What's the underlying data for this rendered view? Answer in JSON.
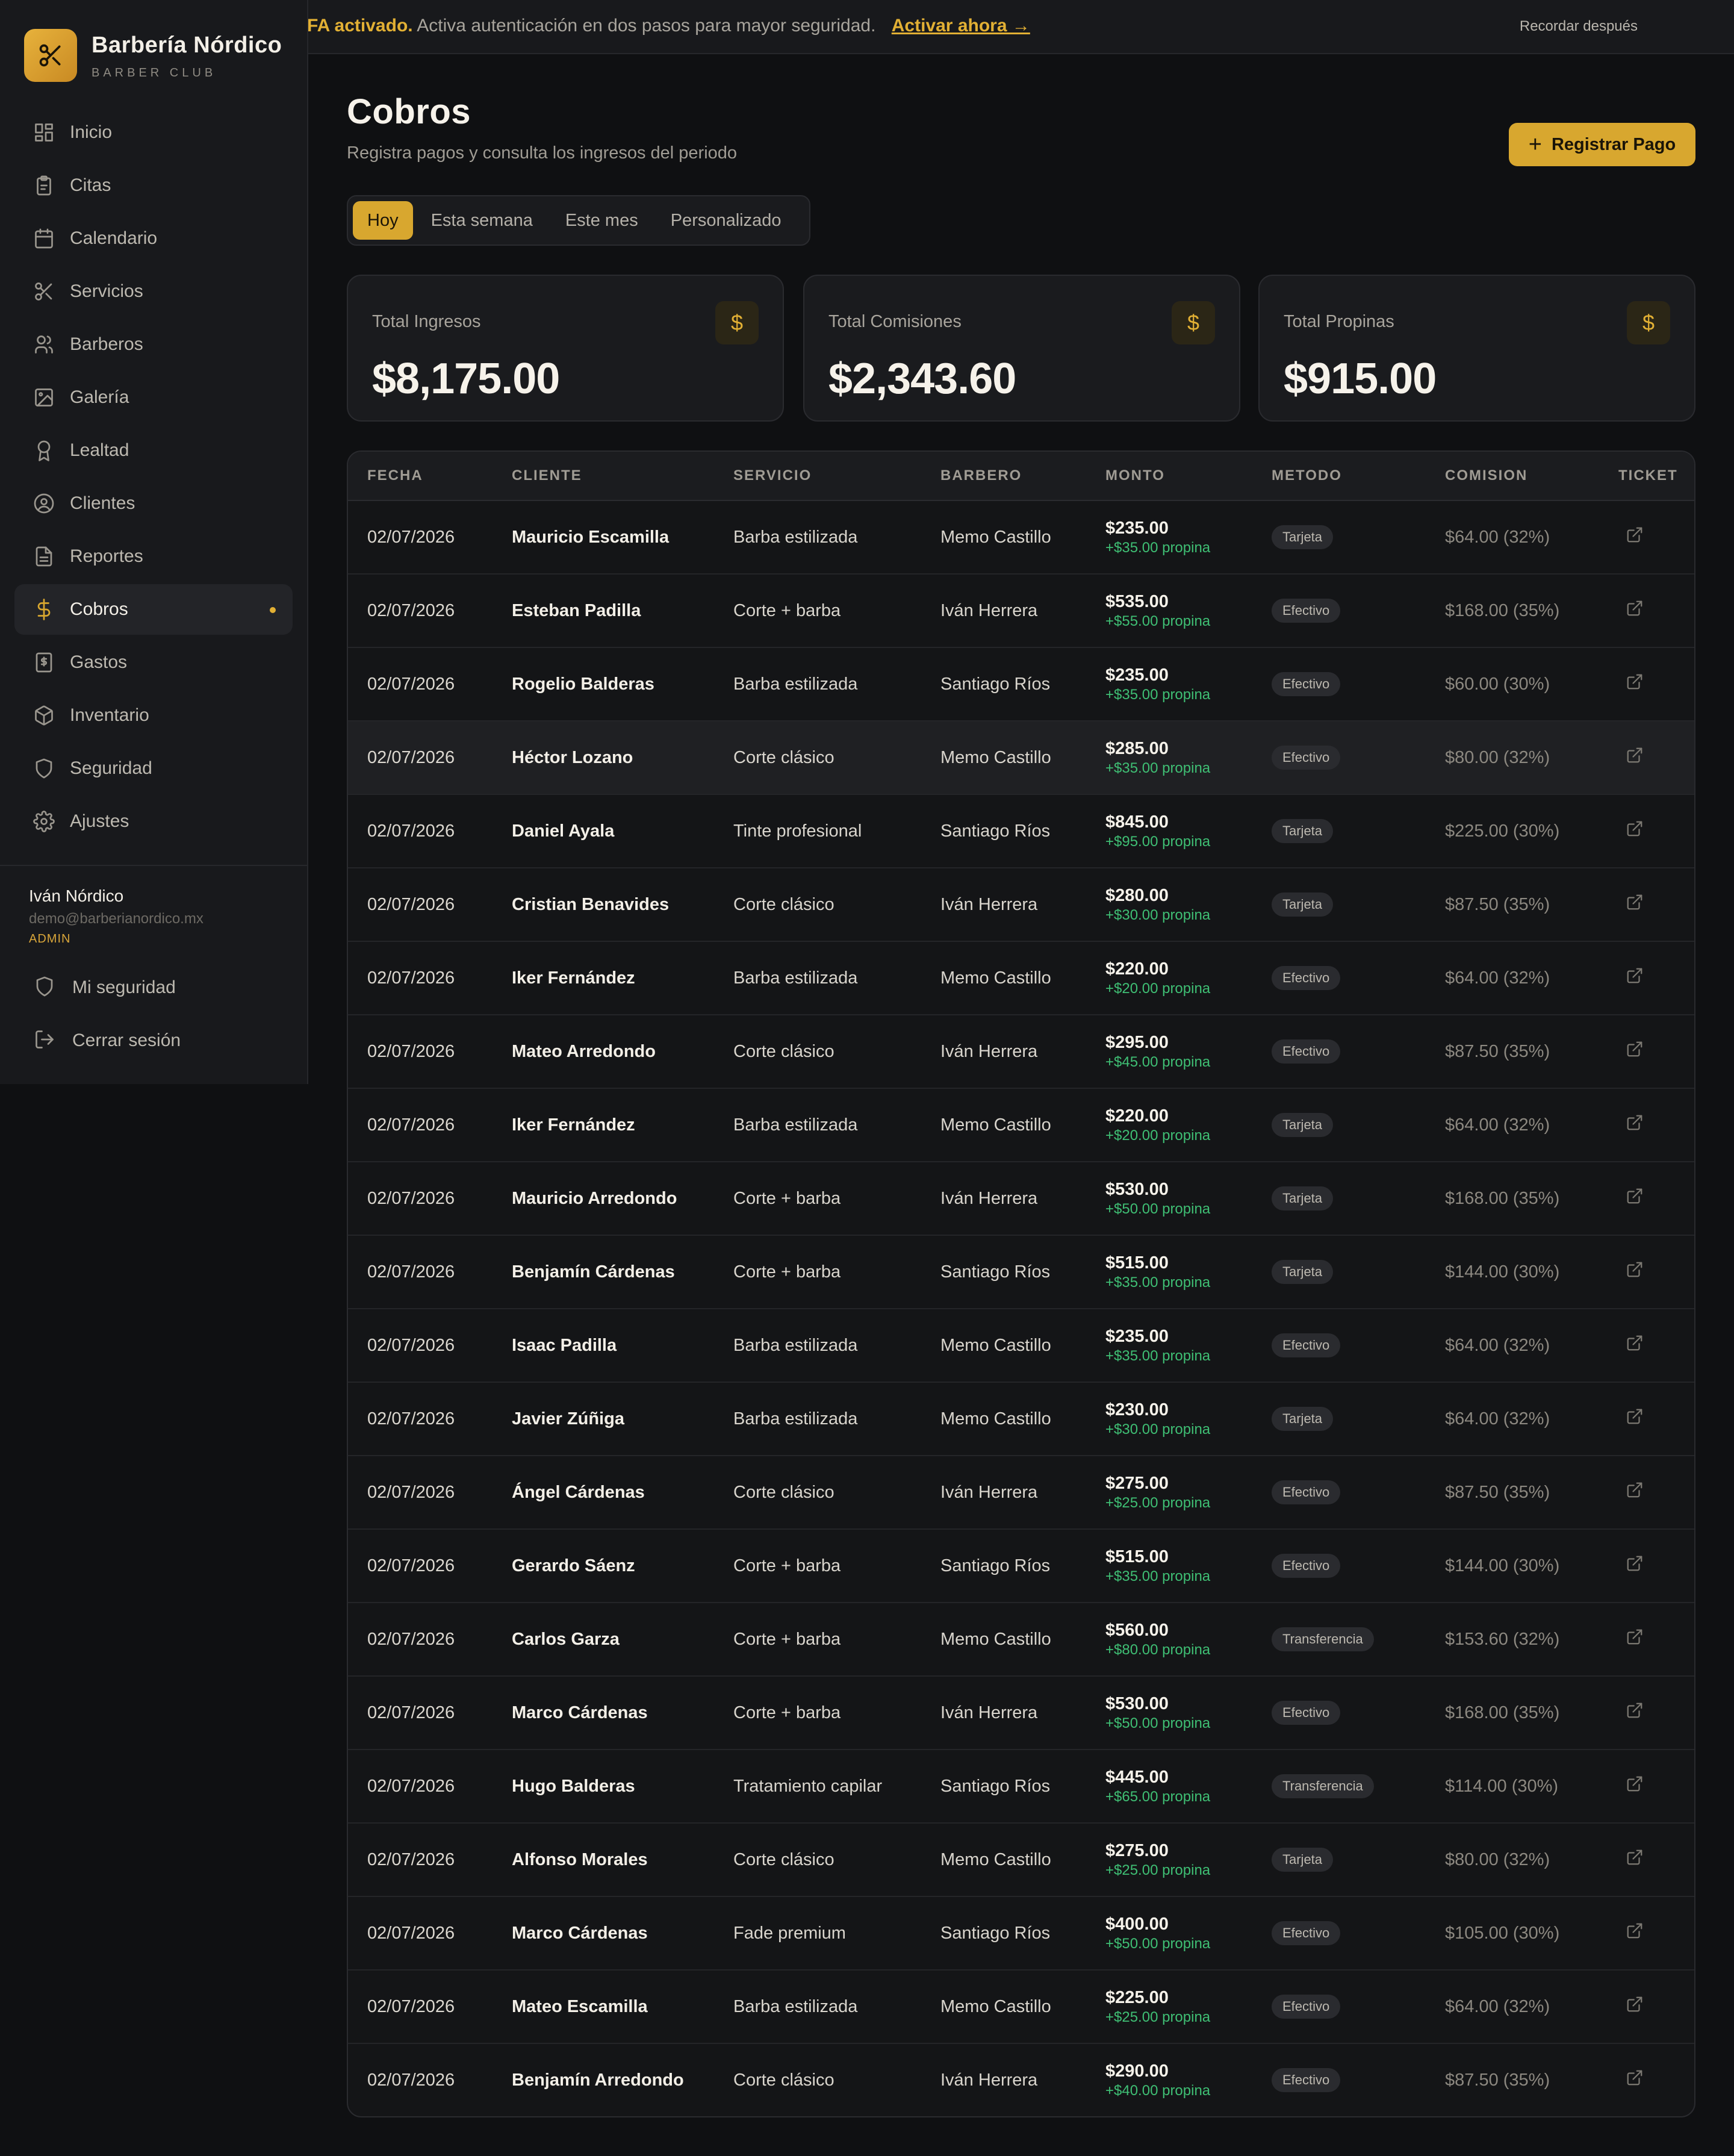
{
  "banner": {
    "strong": "FA activado.",
    "text": "Activa autenticación en dos pasos para mayor seguridad.",
    "link": "Activar ahora →",
    "later": "Recordar después"
  },
  "brand": {
    "name": "Barbería Nórdico",
    "sub": "BARBER CLUB"
  },
  "nav": [
    {
      "label": "Inicio",
      "icon": "grid-icon"
    },
    {
      "label": "Citas",
      "icon": "clipboard-icon"
    },
    {
      "label": "Calendario",
      "icon": "calendar-icon"
    },
    {
      "label": "Servicios",
      "icon": "scissors-icon"
    },
    {
      "label": "Barberos",
      "icon": "users-icon"
    },
    {
      "label": "Galería",
      "icon": "image-icon"
    },
    {
      "label": "Lealtad",
      "icon": "award-icon"
    },
    {
      "label": "Clientes",
      "icon": "user-circle-icon"
    },
    {
      "label": "Reportes",
      "icon": "file-text-icon"
    },
    {
      "label": "Cobros",
      "icon": "dollar-icon",
      "active": true
    },
    {
      "label": "Gastos",
      "icon": "receipt-icon"
    },
    {
      "label": "Inventario",
      "icon": "package-icon"
    },
    {
      "label": "Seguridad",
      "icon": "shield-icon"
    },
    {
      "label": "Ajustes",
      "icon": "gear-icon"
    }
  ],
  "user": {
    "name": "Iván Nórdico",
    "email": "demo@barberianordico.mx",
    "role": "ADMIN",
    "security_label": "Mi seguridad",
    "logout_label": "Cerrar sesión"
  },
  "page": {
    "title": "Cobros",
    "subtitle": "Registra pagos y consulta los ingresos del periodo",
    "register_button": "Registrar Pago"
  },
  "tabs": [
    {
      "label": "Hoy",
      "active": true
    },
    {
      "label": "Esta semana"
    },
    {
      "label": "Este mes"
    },
    {
      "label": "Personalizado"
    }
  ],
  "stats": [
    {
      "label": "Total Ingresos",
      "value": "$8,175.00",
      "icon": "$"
    },
    {
      "label": "Total Comisiones",
      "value": "$2,343.60",
      "icon": "$"
    },
    {
      "label": "Total Propinas",
      "value": "$915.00",
      "icon": "$"
    }
  ],
  "table": {
    "headers": [
      "FECHA",
      "CLIENTE",
      "SERVICIO",
      "BARBERO",
      "MONTO",
      "METODO",
      "COMISION",
      "TICKET"
    ],
    "rows": [
      {
        "date": "02/07/2026",
        "client": "Mauricio Escamilla",
        "service": "Barba estilizada",
        "barber": "Memo Castillo",
        "amount": "$235.00",
        "tip": "+$35.00 propina",
        "method": "Tarjeta",
        "commission": "$64.00 (32%)"
      },
      {
        "date": "02/07/2026",
        "client": "Esteban Padilla",
        "service": "Corte + barba",
        "barber": "Iván Herrera",
        "amount": "$535.00",
        "tip": "+$55.00 propina",
        "method": "Efectivo",
        "commission": "$168.00 (35%)"
      },
      {
        "date": "02/07/2026",
        "client": "Rogelio Balderas",
        "service": "Barba estilizada",
        "barber": "Santiago Ríos",
        "amount": "$235.00",
        "tip": "+$35.00 propina",
        "method": "Efectivo",
        "commission": "$60.00 (30%)"
      },
      {
        "date": "02/07/2026",
        "client": "Héctor Lozano",
        "service": "Corte clásico",
        "barber": "Memo Castillo",
        "amount": "$285.00",
        "tip": "+$35.00 propina",
        "method": "Efectivo",
        "commission": "$80.00 (32%)",
        "highlight": true
      },
      {
        "date": "02/07/2026",
        "client": "Daniel Ayala",
        "service": "Tinte profesional",
        "barber": "Santiago Ríos",
        "amount": "$845.00",
        "tip": "+$95.00 propina",
        "method": "Tarjeta",
        "commission": "$225.00 (30%)"
      },
      {
        "date": "02/07/2026",
        "client": "Cristian Benavides",
        "service": "Corte clásico",
        "barber": "Iván Herrera",
        "amount": "$280.00",
        "tip": "+$30.00 propina",
        "method": "Tarjeta",
        "commission": "$87.50 (35%)"
      },
      {
        "date": "02/07/2026",
        "client": "Iker Fernández",
        "service": "Barba estilizada",
        "barber": "Memo Castillo",
        "amount": "$220.00",
        "tip": "+$20.00 propina",
        "method": "Efectivo",
        "commission": "$64.00 (32%)"
      },
      {
        "date": "02/07/2026",
        "client": "Mateo Arredondo",
        "service": "Corte clásico",
        "barber": "Iván Herrera",
        "amount": "$295.00",
        "tip": "+$45.00 propina",
        "method": "Efectivo",
        "commission": "$87.50 (35%)"
      },
      {
        "date": "02/07/2026",
        "client": "Iker Fernández",
        "service": "Barba estilizada",
        "barber": "Memo Castillo",
        "amount": "$220.00",
        "tip": "+$20.00 propina",
        "method": "Tarjeta",
        "commission": "$64.00 (32%)"
      },
      {
        "date": "02/07/2026",
        "client": "Mauricio Arredondo",
        "service": "Corte + barba",
        "barber": "Iván Herrera",
        "amount": "$530.00",
        "tip": "+$50.00 propina",
        "method": "Tarjeta",
        "commission": "$168.00 (35%)"
      },
      {
        "date": "02/07/2026",
        "client": "Benjamín Cárdenas",
        "service": "Corte + barba",
        "barber": "Santiago Ríos",
        "amount": "$515.00",
        "tip": "+$35.00 propina",
        "method": "Tarjeta",
        "commission": "$144.00 (30%)"
      },
      {
        "date": "02/07/2026",
        "client": "Isaac Padilla",
        "service": "Barba estilizada",
        "barber": "Memo Castillo",
        "amount": "$235.00",
        "tip": "+$35.00 propina",
        "method": "Efectivo",
        "commission": "$64.00 (32%)"
      },
      {
        "date": "02/07/2026",
        "client": "Javier Zúñiga",
        "service": "Barba estilizada",
        "barber": "Memo Castillo",
        "amount": "$230.00",
        "tip": "+$30.00 propina",
        "method": "Tarjeta",
        "commission": "$64.00 (32%)"
      },
      {
        "date": "02/07/2026",
        "client": "Ángel Cárdenas",
        "service": "Corte clásico",
        "barber": "Iván Herrera",
        "amount": "$275.00",
        "tip": "+$25.00 propina",
        "method": "Efectivo",
        "commission": "$87.50 (35%)"
      },
      {
        "date": "02/07/2026",
        "client": "Gerardo Sáenz",
        "service": "Corte + barba",
        "barber": "Santiago Ríos",
        "amount": "$515.00",
        "tip": "+$35.00 propina",
        "method": "Efectivo",
        "commission": "$144.00 (30%)"
      },
      {
        "date": "02/07/2026",
        "client": "Carlos Garza",
        "service": "Corte + barba",
        "barber": "Memo Castillo",
        "amount": "$560.00",
        "tip": "+$80.00 propina",
        "method": "Transferencia",
        "commission": "$153.60 (32%)"
      },
      {
        "date": "02/07/2026",
        "client": "Marco Cárdenas",
        "service": "Corte + barba",
        "barber": "Iván Herrera",
        "amount": "$530.00",
        "tip": "+$50.00 propina",
        "method": "Efectivo",
        "commission": "$168.00 (35%)"
      },
      {
        "date": "02/07/2026",
        "client": "Hugo Balderas",
        "service": "Tratamiento capilar",
        "barber": "Santiago Ríos",
        "amount": "$445.00",
        "tip": "+$65.00 propina",
        "method": "Transferencia",
        "commission": "$114.00 (30%)"
      },
      {
        "date": "02/07/2026",
        "client": "Alfonso Morales",
        "service": "Corte clásico",
        "barber": "Memo Castillo",
        "amount": "$275.00",
        "tip": "+$25.00 propina",
        "method": "Tarjeta",
        "commission": "$80.00 (32%)"
      },
      {
        "date": "02/07/2026",
        "client": "Marco Cárdenas",
        "service": "Fade premium",
        "barber": "Santiago Ríos",
        "amount": "$400.00",
        "tip": "+$50.00 propina",
        "method": "Efectivo",
        "commission": "$105.00 (30%)"
      },
      {
        "date": "02/07/2026",
        "client": "Mateo Escamilla",
        "service": "Barba estilizada",
        "barber": "Memo Castillo",
        "amount": "$225.00",
        "tip": "+$25.00 propina",
        "method": "Efectivo",
        "commission": "$64.00 (32%)"
      },
      {
        "date": "02/07/2026",
        "client": "Benjamín Arredondo",
        "service": "Corte clásico",
        "barber": "Iván Herrera",
        "amount": "$290.00",
        "tip": "+$40.00 propina",
        "method": "Efectivo",
        "commission": "$87.50 (35%)"
      }
    ]
  },
  "colors": {
    "accent": "#d8a72f",
    "background": "#0f1012",
    "surface": "#1a1b1e",
    "tip_green": "#3fbf74"
  }
}
